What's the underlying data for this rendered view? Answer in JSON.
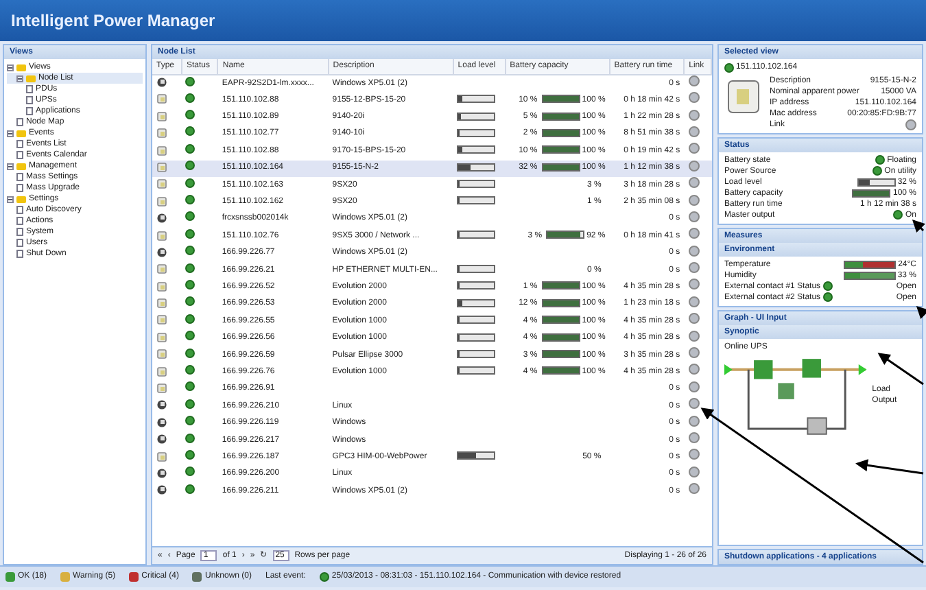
{
  "header": {
    "title": "Intelligent Power Manager"
  },
  "menu": {
    "title": "Views",
    "items": [
      {
        "label": "Views",
        "expanded": true,
        "selected": false,
        "children": [
          {
            "label": "Node List",
            "expanded": true,
            "selected": true,
            "children": [
              {
                "label": "PDUs",
                "selected": false
              },
              {
                "label": "UPSs",
                "selected": false
              },
              {
                "label": "Applications",
                "selected": false
              }
            ]
          },
          {
            "label": "Node Map",
            "selected": false
          }
        ]
      },
      {
        "label": "Events",
        "expanded": true,
        "selected": false,
        "children": [
          {
            "label": "Events List",
            "selected": false
          },
          {
            "label": "Events Calendar",
            "selected": false
          }
        ]
      },
      {
        "label": "Management",
        "expanded": true,
        "selected": false,
        "children": [
          {
            "label": "Mass Settings",
            "selected": false
          },
          {
            "label": "Mass Upgrade",
            "selected": false
          }
        ]
      },
      {
        "label": "Settings",
        "expanded": true,
        "selected": false,
        "children": [
          {
            "label": "Auto Discovery",
            "selected": false
          },
          {
            "label": "Actions",
            "selected": false
          },
          {
            "label": "System",
            "selected": false
          },
          {
            "label": "Users",
            "selected": false
          },
          {
            "label": "Shut Down",
            "selected": false
          }
        ]
      }
    ]
  },
  "table": {
    "title": "Node List",
    "columns": [
      "Type",
      "Status",
      "Name",
      "Description",
      "Load level",
      "Battery capacity",
      "Battery run time",
      "Link"
    ],
    "rows": [
      {
        "kind": "computer",
        "name": "EAPR-92S2D1-lm.xxxx...",
        "description": "Windows XP5.01 (2)",
        "runtime": "0 s",
        "selected": false
      },
      {
        "kind": "ups",
        "name": "151.110.102.88",
        "description": "9155-12-BPS-15-20",
        "load": {
          "level": 0.1,
          "text": "10 %"
        },
        "battery": {
          "level": 1,
          "text": "100 %"
        },
        "runtime": "0 h 18 min 42 s",
        "selected": false
      },
      {
        "kind": "ups",
        "name": "151.110.102.89",
        "description": "9140-20i",
        "load": {
          "level": 0.05,
          "text": "5 %"
        },
        "battery": {
          "level": 1,
          "text": "100 %"
        },
        "runtime": "1 h 22 min 28 s",
        "selected": false
      },
      {
        "kind": "ups",
        "name": "151.110.102.77",
        "description": "9140-10i",
        "load": {
          "level": 0.02,
          "text": "2 %"
        },
        "battery": {
          "level": 1,
          "text": "100 %"
        },
        "runtime": "8 h 51 min 38 s",
        "selected": false
      },
      {
        "kind": "ups",
        "name": "151.110.102.88",
        "description": "9170-15-BPS-15-20",
        "load": {
          "level": 0.1,
          "text": "10 %"
        },
        "battery": {
          "level": 1,
          "text": "100 %"
        },
        "runtime": "0 h 19 min 42 s",
        "selected": false
      },
      {
        "kind": "ups",
        "name": "151.110.102.164",
        "description": "9155-15-N-2",
        "load": {
          "level": 0.32,
          "text": "32 %"
        },
        "battery": {
          "level": 1,
          "text": "100 %"
        },
        "runtime": "1 h 12 min 38 s",
        "selected": true
      },
      {
        "kind": "ups",
        "name": "151.110.102.163",
        "description": "9SX20",
        "load": {
          "level": 0.03,
          "text": "3 %"
        },
        "runtime": "3 h 18 min 28 s",
        "selected": false
      },
      {
        "kind": "ups",
        "name": "151.110.102.162",
        "description": "9SX20",
        "load": {
          "level": 0.01,
          "text": "1 %"
        },
        "runtime": "2 h 35 min 08 s",
        "selected": false
      },
      {
        "kind": "computer",
        "name": "frcxsnssb002014k",
        "description": "Windows XP5.01 (2)",
        "runtime": "0 s",
        "selected": false
      },
      {
        "kind": "ups",
        "name": "151.110.102.76",
        "description": "9SX5 3000 / Network ...",
        "load": {
          "level": 0.03,
          "text": "3 %"
        },
        "battery": {
          "level": 0.92,
          "text": "92 %"
        },
        "runtime": "0 h 18 min 41 s",
        "selected": false
      },
      {
        "kind": "computer",
        "name": "166.99.226.77",
        "description": "Windows XP5.01 (2)",
        "runtime": "0 s",
        "selected": false
      },
      {
        "kind": "ups",
        "name": "166.99.226.21",
        "description": "HP ETHERNET MULTI-EN...",
        "load": {
          "level": 0.02,
          "text": "0 %"
        },
        "runtime": "0 s",
        "selected": false
      },
      {
        "kind": "ups",
        "name": "166.99.226.52",
        "description": "Evolution 2000",
        "load": {
          "level": 0.01,
          "text": "1 %"
        },
        "battery": {
          "level": 1,
          "text": "100 %"
        },
        "runtime": "4 h 35 min 28 s",
        "selected": false
      },
      {
        "kind": "ups",
        "name": "166.99.226.53",
        "description": "Evolution 2000",
        "load": {
          "level": 0.12,
          "text": "12 %"
        },
        "battery": {
          "level": 1,
          "text": "100 %"
        },
        "runtime": "1 h 23 min 18 s",
        "selected": false
      },
      {
        "kind": "ups",
        "name": "166.99.226.55",
        "description": "Evolution 1000",
        "load": {
          "level": 0.04,
          "text": "4 %"
        },
        "battery": {
          "level": 1,
          "text": "100 %"
        },
        "runtime": "4 h 35 min 28 s",
        "selected": false
      },
      {
        "kind": "ups",
        "name": "166.99.226.56",
        "description": "Evolution 1000",
        "load": {
          "level": 0.04,
          "text": "4 %"
        },
        "battery": {
          "level": 1,
          "text": "100 %"
        },
        "runtime": "4 h 35 min 28 s",
        "selected": false
      },
      {
        "kind": "ups",
        "name": "166.99.226.59",
        "description": "Pulsar Ellipse 3000",
        "load": {
          "level": 0.03,
          "text": "3 %"
        },
        "battery": {
          "level": 1,
          "text": "100 %"
        },
        "runtime": "3 h 35 min 28 s",
        "selected": false
      },
      {
        "kind": "ups",
        "name": "166.99.226.76",
        "description": "Evolution 1000",
        "load": {
          "level": 0.04,
          "text": "4 %"
        },
        "battery": {
          "level": 1,
          "text": "100 %"
        },
        "runtime": "4 h 35 min 28 s",
        "selected": false
      },
      {
        "kind": "ups",
        "name": "166.99.226.91",
        "runtime": "0 s",
        "selected": false
      },
      {
        "kind": "computer",
        "name": "166.99.226.210",
        "description": "Linux",
        "runtime": "0 s",
        "selected": false
      },
      {
        "kind": "computer",
        "name": "166.99.226.119",
        "description": "Windows",
        "runtime": "0 s",
        "selected": false
      },
      {
        "kind": "computer",
        "name": "166.99.226.217",
        "description": "Windows",
        "runtime": "0 s",
        "selected": false
      },
      {
        "kind": "ups",
        "name": "166.99.226.187",
        "description": "GPC3 HIM-00-WebPower",
        "load": {
          "level": 0.5,
          "text": "50 %"
        },
        "runtime": "0 s",
        "selected": false
      },
      {
        "kind": "computer",
        "name": "166.99.226.200",
        "description": "Linux",
        "runtime": "0 s",
        "selected": false
      },
      {
        "kind": "computer",
        "name": "166.99.226.211",
        "description": "Windows XP5.01 (2)",
        "runtime": "0 s",
        "selected": false
      }
    ],
    "pager": {
      "first": "«",
      "prev": "‹",
      "next": "›",
      "last": "»",
      "refresh": "↻",
      "page_label": "Page",
      "page": "1",
      "of": "of 1",
      "per_page": "25",
      "per_page_label": "Rows per page",
      "summary": "Displaying 1 - 26 of 26"
    }
  },
  "selected_view": {
    "title": "Selected view",
    "node": "151.110.102.164",
    "properties": [
      {
        "label": "Description",
        "value": "9155-15-N-2"
      },
      {
        "label": "Nominal apparent power",
        "value": "15000 VA"
      },
      {
        "label": "IP address",
        "value": "151.110.102.164"
      },
      {
        "label": "Mac address",
        "value": "00:20:85:FD:9B:77"
      },
      {
        "kind": "link",
        "label": "Link"
      }
    ]
  },
  "status": {
    "title": "Status",
    "items": [
      {
        "kind": "icon",
        "label": "Battery state",
        "value": "Floating"
      },
      {
        "kind": "icon",
        "label": "Power Source",
        "value": "On utility"
      },
      {
        "kind": "meter",
        "label": "Load level",
        "level": 0.32,
        "value": "32 %"
      },
      {
        "kind": "meter",
        "label": "Battery capacity",
        "level": 1,
        "value": "100 %"
      },
      {
        "kind": "text",
        "label": "Battery run time",
        "value": "1 h 12 min 38 s"
      },
      {
        "kind": "icon",
        "label": "Master output",
        "value": "On"
      }
    ]
  },
  "measures": {
    "title": "Measures",
    "group": "Environment",
    "items": [
      {
        "kind": "gauge",
        "label": "Temperature",
        "level": 0.35,
        "value": "24°C"
      },
      {
        "kind": "gauge",
        "label": "Humidity",
        "level": 0.3,
        "value": "33 %"
      },
      {
        "kind": "contact",
        "label": "External contact #1 Status",
        "value": "Open"
      },
      {
        "kind": "contact",
        "label": "External contact #2 Status",
        "value": "Open"
      }
    ]
  },
  "graph": {
    "title": "Graph - UI Input",
    "synoptic": "Synoptic",
    "caption": "Online UPS",
    "output": "Load Output"
  },
  "shutdown": {
    "title": "Shutdown applications - 4 applications"
  },
  "status_bar": [
    {
      "kind": "ok",
      "text": "OK (18)"
    },
    {
      "kind": "warning",
      "text": "Warning (5)"
    },
    {
      "kind": "critical",
      "text": "Critical (4)"
    },
    {
      "kind": "unknown",
      "text": "Unknown (0)"
    }
  ],
  "last_event": {
    "label": "Last event:",
    "text": "25/03/2013 - 08:31:03 - 151.110.102.164 - Communication with device restored"
  }
}
